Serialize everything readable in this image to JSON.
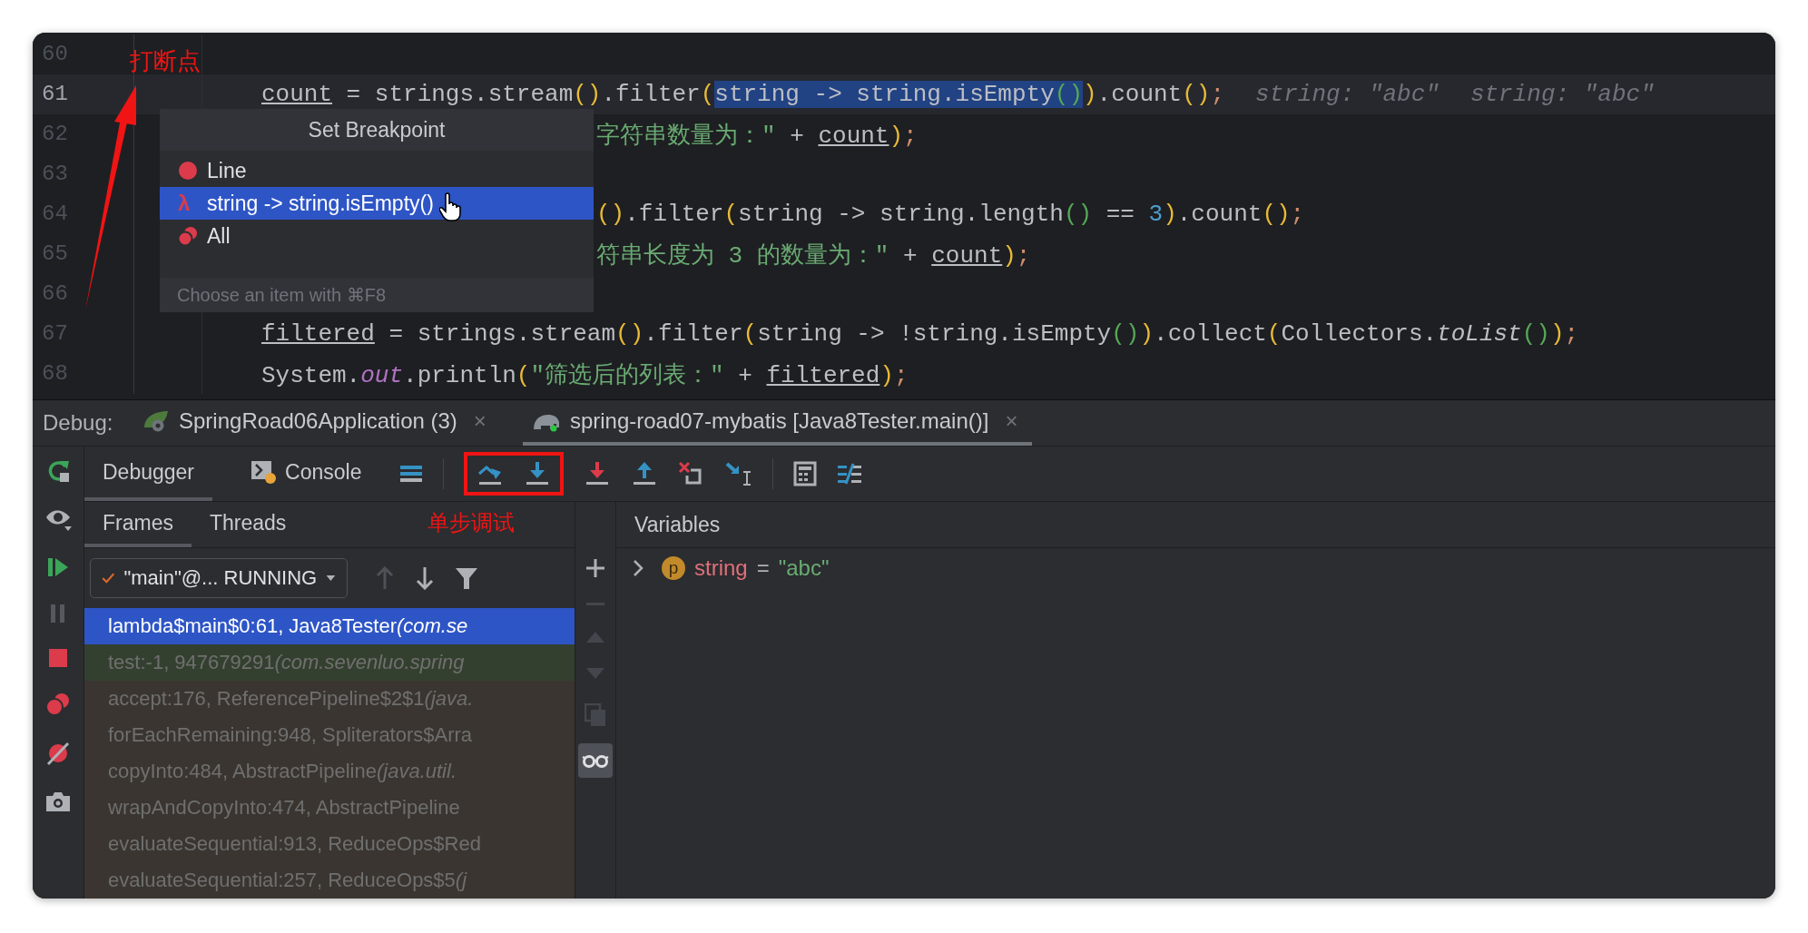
{
  "editor": {
    "lines": [
      {
        "number": "60",
        "current": false,
        "kind": "full"
      },
      {
        "number": "61",
        "current": true,
        "kind": "full",
        "tokens": [
          {
            "text": "count",
            "kind": "field"
          },
          {
            "text": " = strings.stream",
            "kind": "plain"
          },
          {
            "text": "()",
            "kind": "paren"
          },
          {
            "text": ".filter",
            "kind": "plain"
          },
          {
            "text": "(",
            "kind": "paren"
          },
          {
            "text": "string -> string.isEmpty",
            "kind": "sel"
          },
          {
            "text": "()",
            "kind": "selparen"
          },
          {
            "text": ")",
            "kind": "paren"
          },
          {
            "text": ".count",
            "kind": "plain"
          },
          {
            "text": "()",
            "kind": "paren"
          },
          {
            "text": ";",
            "kind": "semi"
          }
        ],
        "hints": [
          "string: \"abc\"",
          "string: \"abc\""
        ]
      },
      {
        "number": "62",
        "current": false,
        "kind": "partial",
        "tokens": [
          {
            "text": "字符串数量为：\" ",
            "kind": "str"
          },
          {
            "text": "+ ",
            "kind": "plain"
          },
          {
            "text": "count",
            "kind": "field"
          },
          {
            "text": ")",
            "kind": "paren"
          },
          {
            "text": ";",
            "kind": "semi"
          }
        ]
      },
      {
        "number": "63",
        "current": false,
        "kind": "full"
      },
      {
        "number": "64",
        "current": false,
        "kind": "partial",
        "tokens": [
          {
            "text": "()",
            "kind": "paren"
          },
          {
            "text": ".filter",
            "kind": "plain"
          },
          {
            "text": "(",
            "kind": "paren"
          },
          {
            "text": "string -> string.length",
            "kind": "plain"
          },
          {
            "text": "()",
            "kind": "paren2"
          },
          {
            "text": " == ",
            "kind": "plain"
          },
          {
            "text": "3",
            "kind": "num"
          },
          {
            "text": ")",
            "kind": "paren"
          },
          {
            "text": ".count",
            "kind": "plain"
          },
          {
            "text": "()",
            "kind": "paren"
          },
          {
            "text": ";",
            "kind": "semi"
          }
        ]
      },
      {
        "number": "65",
        "current": false,
        "kind": "partial",
        "tokens": [
          {
            "text": "符串长度为 3 的数量为：\" ",
            "kind": "str"
          },
          {
            "text": "+ ",
            "kind": "plain"
          },
          {
            "text": "count",
            "kind": "field"
          },
          {
            "text": ")",
            "kind": "paren"
          },
          {
            "text": ";",
            "kind": "semi"
          }
        ]
      },
      {
        "number": "66",
        "current": false,
        "kind": "full"
      },
      {
        "number": "67",
        "current": false,
        "kind": "full",
        "tokens": [
          {
            "text": "filtered",
            "kind": "field"
          },
          {
            "text": " = strings.stream",
            "kind": "plain"
          },
          {
            "text": "()",
            "kind": "paren"
          },
          {
            "text": ".filter",
            "kind": "plain"
          },
          {
            "text": "(",
            "kind": "paren"
          },
          {
            "text": "string -> !string.isEmpty",
            "kind": "plain"
          },
          {
            "text": "()",
            "kind": "paren2"
          },
          {
            "text": ")",
            "kind": "paren"
          },
          {
            "text": ".collect",
            "kind": "plain"
          },
          {
            "text": "(",
            "kind": "paren"
          },
          {
            "text": "Collectors.",
            "kind": "plain"
          },
          {
            "text": "toList",
            "kind": "italic"
          },
          {
            "text": "()",
            "kind": "paren2"
          },
          {
            "text": ")",
            "kind": "paren"
          },
          {
            "text": ";",
            "kind": "semi"
          }
        ]
      },
      {
        "number": "68",
        "current": false,
        "kind": "full",
        "tokens": [
          {
            "text": "System.",
            "kind": "plain"
          },
          {
            "text": "out",
            "kind": "static"
          },
          {
            "text": ".println",
            "kind": "plain"
          },
          {
            "text": "(",
            "kind": "paren"
          },
          {
            "text": "\"筛选后的列表：\" ",
            "kind": "str"
          },
          {
            "text": "+ ",
            "kind": "plain"
          },
          {
            "text": "filtered",
            "kind": "field"
          },
          {
            "text": ")",
            "kind": "paren"
          },
          {
            "text": ";",
            "kind": "semi"
          }
        ]
      }
    ]
  },
  "popup": {
    "title": "Set Breakpoint",
    "items": [
      {
        "kind": "line",
        "label": "Line",
        "selected": false
      },
      {
        "kind": "lambda",
        "glyph": "λ",
        "label": "string -> string.isEmpty()",
        "selected": true
      },
      {
        "kind": "all",
        "label": "All",
        "selected": false
      }
    ],
    "footer": "Choose an item with ⌘F8"
  },
  "annotations": {
    "breakpoint_note": "打断点",
    "step_note": "单步调试"
  },
  "debug": {
    "label": "Debug:",
    "sessions": [
      {
        "kind": "spring",
        "label": "SpringRoad06Application (3)",
        "close": "×",
        "selected": false
      },
      {
        "kind": "gradle",
        "label": "spring-road07-mybatis [Java8Tester.main()]",
        "close": "×",
        "selected": true
      }
    ],
    "tabs": [
      {
        "kind": "debugger",
        "label": "Debugger",
        "selected": true
      },
      {
        "kind": "console",
        "label": "Console",
        "selected": false
      }
    ],
    "subtabs": [
      {
        "label": "Frames",
        "selected": true
      },
      {
        "label": "Threads",
        "selected": false
      }
    ],
    "thread": {
      "value": "\"main\"@... RUNNING"
    },
    "frames": [
      {
        "kind": "current",
        "selected": true,
        "text": "lambda$main$0:61, Java8Tester",
        "location": "(com.se"
      },
      {
        "kind": "user",
        "selected": false,
        "text": "test:-1, 947679291",
        "location": "(com.sevenluo.spring"
      },
      {
        "kind": "library",
        "selected": false,
        "text": "accept:176, ReferencePipeline$2$1",
        "location": "(java."
      },
      {
        "kind": "library",
        "selected": false,
        "text": "forEachRemaining:948, Spliterators$Arra"
      },
      {
        "kind": "library",
        "selected": false,
        "text": "copyInto:484, AbstractPipeline",
        "location": "(java.util."
      },
      {
        "kind": "library",
        "selected": false,
        "text": "wrapAndCopyInto:474, AbstractPipeline"
      },
      {
        "kind": "library",
        "selected": false,
        "text": "evaluateSequential:913, ReduceOps$Red"
      },
      {
        "kind": "library",
        "selected": false,
        "text": "evaluateSequential:257, ReduceOps$5",
        "location": "(j"
      }
    ],
    "variables": {
      "title": "Variables",
      "items": [
        {
          "badge": "p",
          "name": "string",
          "eq": "=",
          "value": "\"abc\"",
          "expanded": false
        }
      ]
    }
  }
}
